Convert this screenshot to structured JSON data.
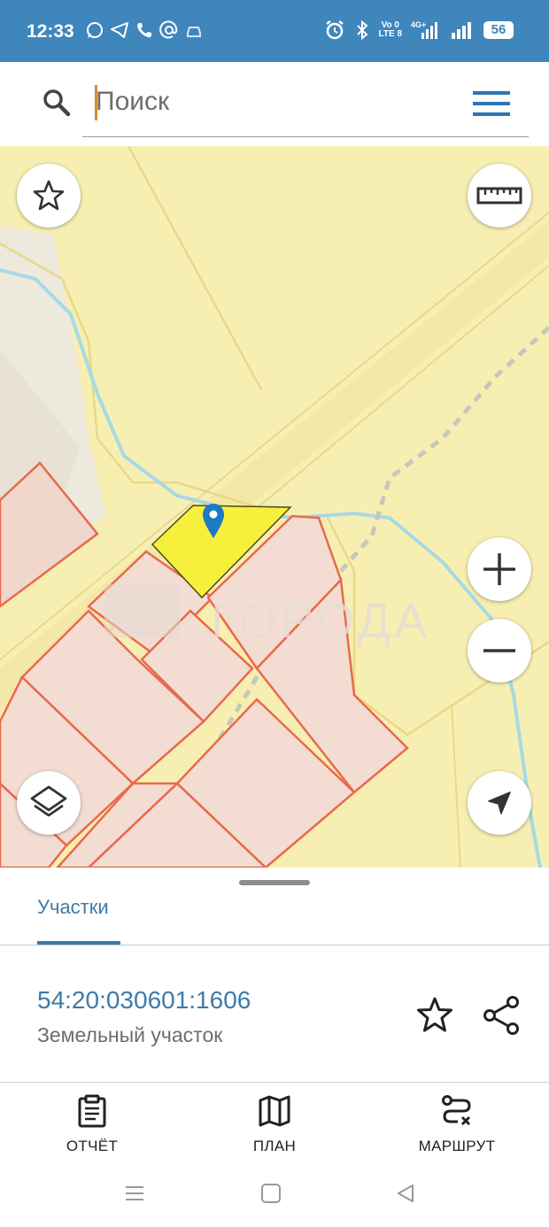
{
  "status_bar": {
    "time": "12:33",
    "network_top": "Vo 0",
    "network_bottom": "LTE 8",
    "battery": "56"
  },
  "search": {
    "placeholder": "Поиск"
  },
  "map": {
    "watermark": "ГОРОДА",
    "colors": {
      "land": "#f7efb2",
      "parcel_fill": "#f3ddd2",
      "parcel_border": "#e9694c",
      "selected_fill": "#f6f03c",
      "water": "#a6d9e6",
      "marker": "#1c79c2"
    }
  },
  "sheet": {
    "tab_label": "Участки",
    "parcel_id": "54:20:030601:1606",
    "parcel_type": "Земельный участок"
  },
  "actions": [
    {
      "label": "ОТЧЁТ",
      "icon": "clipboard-icon"
    },
    {
      "label": "ПЛАН",
      "icon": "map-icon"
    },
    {
      "label": "МАРШРУТ",
      "icon": "route-icon"
    }
  ],
  "accent": "#3d7ba8",
  "statusbar_color": "#3f86bd"
}
